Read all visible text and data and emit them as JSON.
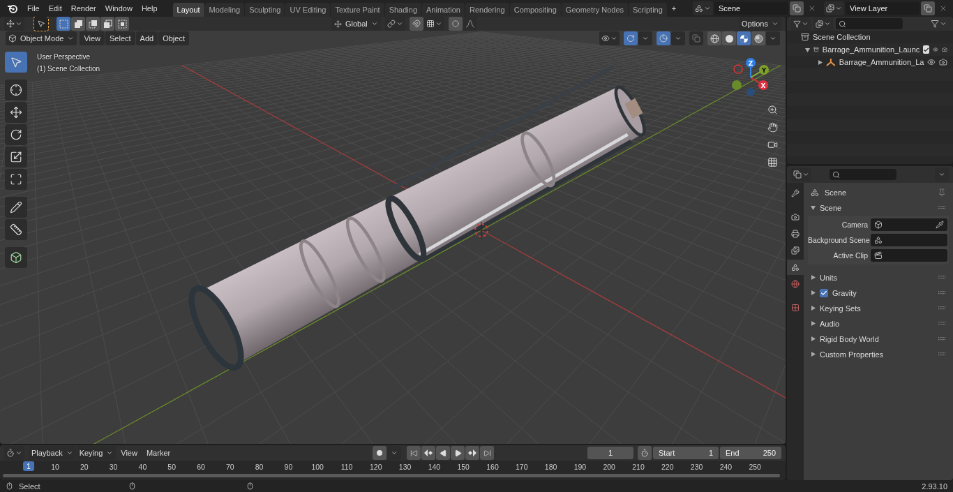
{
  "menu": [
    "File",
    "Edit",
    "Render",
    "Window",
    "Help"
  ],
  "workspaces": [
    {
      "label": "Layout",
      "selected": true
    },
    {
      "label": "Modeling",
      "selected": false
    },
    {
      "label": "Sculpting",
      "selected": false
    },
    {
      "label": "UV Editing",
      "selected": false
    },
    {
      "label": "Texture Paint",
      "selected": false
    },
    {
      "label": "Shading",
      "selected": false
    },
    {
      "label": "Animation",
      "selected": false
    },
    {
      "label": "Rendering",
      "selected": false
    },
    {
      "label": "Compositing",
      "selected": false
    },
    {
      "label": "Geometry Nodes",
      "selected": false
    },
    {
      "label": "Scripting",
      "selected": false
    }
  ],
  "add_workspace": "+",
  "scene_field": "Scene",
  "view_layer_field": "View Layer",
  "viewport": {
    "select_modes": [
      {
        "kind": "set",
        "selected": true
      },
      {
        "kind": "extend",
        "selected": false
      },
      {
        "kind": "subtract",
        "selected": false
      },
      {
        "kind": "invert",
        "selected": false
      },
      {
        "kind": "intersect",
        "selected": false
      }
    ],
    "transform": "Global",
    "options": "Options",
    "mode": "Object Mode",
    "menus": [
      "View",
      "Select",
      "Add",
      "Object"
    ],
    "gizmos_on": true,
    "overlays_on": true,
    "shading": [
      {
        "kind": "wireframe",
        "selected": false
      },
      {
        "kind": "solid",
        "selected": false
      },
      {
        "kind": "material",
        "selected": true
      },
      {
        "kind": "rendered",
        "selected": false
      }
    ],
    "tools": [
      {
        "kind": "select",
        "selected": true
      },
      {
        "kind": "cursor",
        "selected": false
      },
      {
        "kind": "move",
        "selected": false
      },
      {
        "kind": "rotate",
        "selected": false
      },
      {
        "kind": "scale",
        "selected": false
      },
      {
        "kind": "transform",
        "selected": false
      },
      {
        "kind": "annotate",
        "selected": false
      },
      {
        "kind": "measure",
        "selected": false
      },
      {
        "kind": "add_cube",
        "selected": false
      }
    ],
    "overlay_lines": [
      "User Perspective",
      "(1) Scene Collection"
    ],
    "axes": [
      "X",
      "Y",
      "Z"
    ]
  },
  "outliner": {
    "root": "Scene Collection",
    "items": [
      {
        "label": "Barrage_Ammunition_Launc",
        "expanded": true,
        "checked": true,
        "children": [
          {
            "label": "Barrage_Ammunition_La",
            "expanded": false
          }
        ]
      }
    ]
  },
  "properties": {
    "tabs": [
      {
        "kind": "tool",
        "selected": false
      },
      {
        "kind": "render",
        "selected": false
      },
      {
        "kind": "output",
        "selected": false
      },
      {
        "kind": "view_layer",
        "selected": false
      },
      {
        "kind": "scene",
        "selected": true
      },
      {
        "kind": "world",
        "selected": false
      },
      {
        "kind": "texture",
        "selected": false
      }
    ],
    "context": "Scene",
    "panel": {
      "title": "Scene",
      "expanded": true,
      "fields": [
        {
          "label": "Camera",
          "kind": "camera"
        },
        {
          "label": "Background Scene",
          "kind": "scene"
        },
        {
          "label": "Active Clip",
          "kind": "clip"
        }
      ]
    },
    "subpanels": [
      {
        "title": "Units",
        "expanded": false
      },
      {
        "title": "Gravity",
        "expanded": false,
        "checked": true
      },
      {
        "title": "Keying Sets",
        "expanded": false
      },
      {
        "title": "Audio",
        "expanded": false
      },
      {
        "title": "Rigid Body World",
        "expanded": false
      },
      {
        "title": "Custom Properties",
        "expanded": false
      }
    ]
  },
  "timeline": {
    "menus": [
      {
        "label": "Playback",
        "dropdown": true
      },
      {
        "label": "Keying",
        "dropdown": true
      },
      {
        "label": "View",
        "dropdown": false
      },
      {
        "label": "Marker",
        "dropdown": false
      }
    ],
    "current_frame": "1",
    "start_label": "Start",
    "start": "1",
    "end_label": "End",
    "end": "250",
    "ruler": [
      "1",
      "10",
      "20",
      "30",
      "40",
      "50",
      "60",
      "70",
      "80",
      "90",
      "100",
      "110",
      "120",
      "130",
      "140",
      "150",
      "160",
      "170",
      "180",
      "190",
      "200",
      "210",
      "220",
      "230",
      "240",
      "250"
    ]
  },
  "status": {
    "hint": "Select",
    "version": "2.93.10"
  }
}
